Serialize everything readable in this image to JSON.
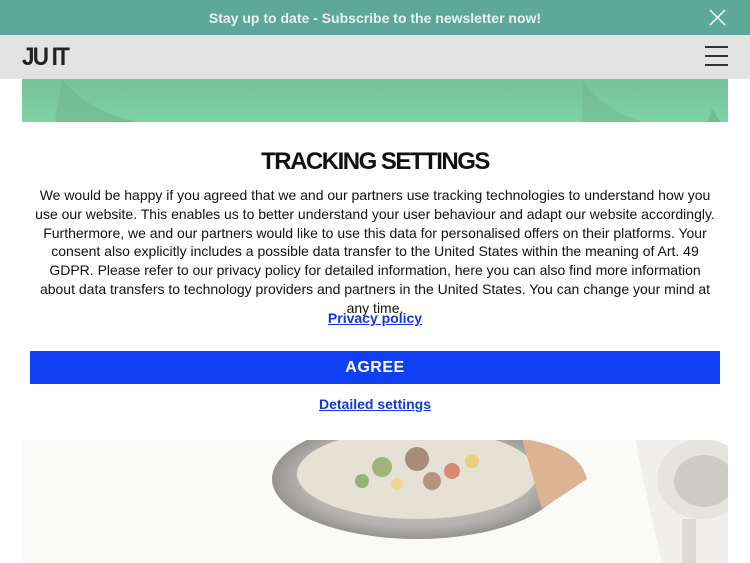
{
  "announcement": {
    "text": "Stay up to date - Subscribe to the newsletter now!",
    "close_icon": "close-icon"
  },
  "header": {
    "logo": "JU IT",
    "menu_icon": "hamburger-menu-icon"
  },
  "modal": {
    "title": "TRACKING SETTINGS",
    "body": "We would be happy if you agreed that we and our partners use tracking technologies to understand how you use our website. This enables us to better understand your user behaviour and adapt our website accordingly. Furthermore, we and our partners would like to use this data for personalised offers on their platforms. Your consent also explicitly includes a possible data transfer to the United States within the meaning of Art. 49 GDPR. Please refer to our privacy policy for detailed information, here you can also find more information about data transfers to technology providers and partners in the United States. You can change your mind at any time.",
    "privacy_link": "Privacy policy",
    "agree_button": "AGREE",
    "detailed_link": "Detailed settings"
  },
  "colors": {
    "announcement_bg": "#5ea79b",
    "header_bg": "#e3e3e3",
    "agree_button_bg": "#1040f3",
    "link": "#1238d8"
  }
}
